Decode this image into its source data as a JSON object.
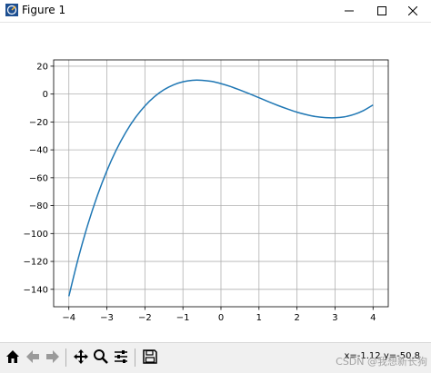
{
  "window": {
    "title": "Figure 1",
    "controls": [
      "minimize",
      "maximize",
      "close"
    ]
  },
  "toolbar": {
    "buttons": [
      "home-icon",
      "back-icon",
      "forward-icon",
      "pan-icon",
      "zoom-icon",
      "configure-subplots-icon",
      "save-icon"
    ],
    "coords_text": "x=-1.12 y=-50.8"
  },
  "watermark": "CSDN @我想新长狗",
  "chart_data": {
    "type": "line",
    "title": "",
    "xlabel": "",
    "ylabel": "",
    "xlim": [
      -4.4,
      4.4
    ],
    "ylim": [
      -152.5,
      24.5
    ],
    "xticks": [
      "−4",
      "−3",
      "−2",
      "−1",
      "0",
      "1",
      "2",
      "3",
      "4"
    ],
    "xtick_values": [
      -4,
      -3,
      -2,
      -1,
      0,
      1,
      2,
      3,
      4
    ],
    "yticks": [
      "20",
      "0",
      "−20",
      "−40",
      "−60",
      "−80",
      "−100",
      "−120",
      "−140"
    ],
    "ytick_values": [
      20,
      0,
      -20,
      -40,
      -60,
      -80,
      -100,
      -120,
      -140
    ],
    "grid": true,
    "line_color": "#1f77b4",
    "series": [
      {
        "x": [
          -4,
          -3.75,
          -3.5,
          -3.25,
          -3,
          -2.75,
          -2.5,
          -2.25,
          -2,
          -1.75,
          -1.5,
          -1.25,
          -1,
          -0.75,
          -0.5,
          -0.25,
          0,
          0.25,
          0.5,
          0.75,
          1,
          1.25,
          1.5,
          1.75,
          2,
          2.25,
          2.5,
          2.75,
          3,
          3.25,
          3.5,
          3.75,
          4
        ],
        "y": [
          -145,
          -117.5,
          -93.5,
          -72.8,
          -55,
          -39.9,
          -27.3,
          -16.9,
          -8.5,
          -1.9,
          3.1,
          6.6,
          8.8,
          9.9,
          9.9,
          9.1,
          7.5,
          5.4,
          2.9,
          0.2,
          -2.6,
          -5.5,
          -8.2,
          -10.7,
          -13,
          -14.8,
          -16.2,
          -16.9,
          -17,
          -16.3,
          -14.6,
          -11.8,
          -7.8
        ]
      }
    ]
  }
}
